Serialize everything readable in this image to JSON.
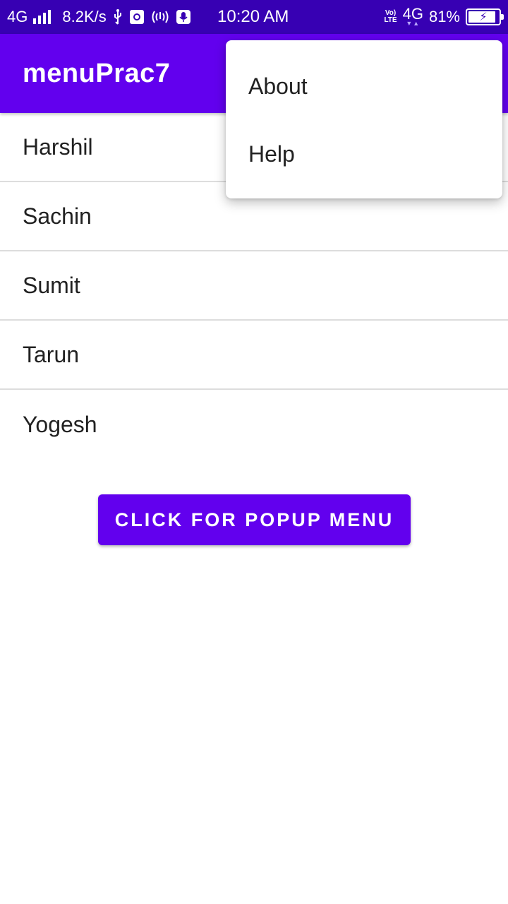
{
  "status_bar": {
    "network_left": "4G",
    "speed": "8.2K/s",
    "time": "10:20 AM",
    "volte_top": "Vo)",
    "volte_bottom": "LTE",
    "network_right": "4G",
    "battery_percent": "81%",
    "icons": [
      "signal-bars-icon",
      "usb-icon",
      "usb-debug-icon",
      "hotspot-icon",
      "microphone-icon",
      "battery-charging-icon"
    ]
  },
  "app_bar": {
    "title": "menuPrac7"
  },
  "list": {
    "items": [
      {
        "label": "Harshil"
      },
      {
        "label": "Sachin"
      },
      {
        "label": "Sumit"
      },
      {
        "label": "Tarun"
      },
      {
        "label": "Yogesh"
      }
    ]
  },
  "button": {
    "label": "CLICK FOR POPUP MENU"
  },
  "overflow_menu": {
    "items": [
      {
        "label": "About"
      },
      {
        "label": "Help"
      }
    ]
  },
  "colors": {
    "status_bar": "#3700b3",
    "primary": "#6200ee",
    "text": "#212121",
    "divider": "#dddddd"
  }
}
